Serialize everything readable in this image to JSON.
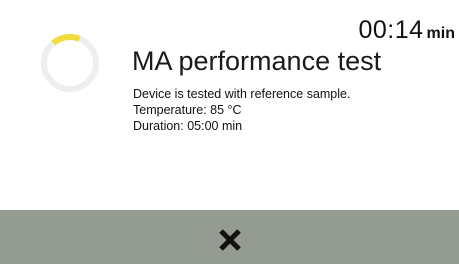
{
  "timer": {
    "value": "00:14",
    "unit": "min"
  },
  "progress": {
    "fraction": 0.17,
    "icon": "progress-ring-icon",
    "accent_color": "#f2dc3c",
    "track_color": "#eeeeee"
  },
  "dialog": {
    "title": "MA performance test",
    "description_lines": [
      "Device is tested with reference sample.",
      "Temperature: 85 °C",
      "Duration: 05:00 min"
    ]
  },
  "footer": {
    "background": "#949c91",
    "cancel_icon": "close-icon"
  }
}
